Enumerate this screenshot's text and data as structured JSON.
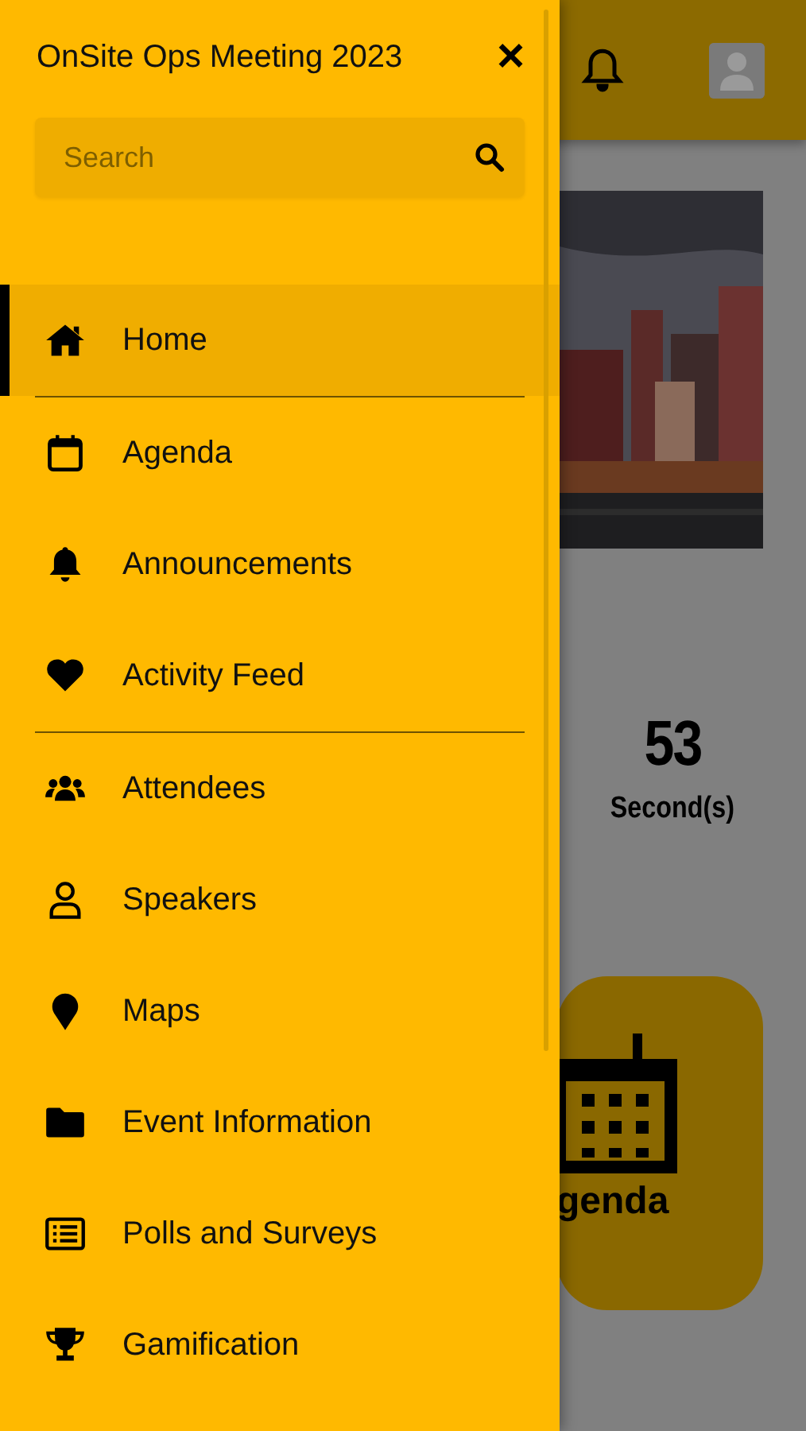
{
  "drawer": {
    "title": "OnSite Ops Meeting 2023",
    "close": "×",
    "search": {
      "placeholder": "Search"
    },
    "menu_groups": [
      [
        {
          "label": "Home",
          "selected": true
        }
      ],
      [
        {
          "label": "Agenda",
          "selected": false
        },
        {
          "label": "Announcements",
          "selected": false
        },
        {
          "label": "Activity Feed",
          "selected": false
        }
      ],
      [
        {
          "label": "Attendees",
          "selected": false
        },
        {
          "label": "Speakers",
          "selected": false
        },
        {
          "label": "Maps",
          "selected": false
        },
        {
          "label": "Event Information",
          "selected": false
        },
        {
          "label": "Polls and Surveys",
          "selected": false
        },
        {
          "label": "Gamification",
          "selected": false
        }
      ]
    ]
  },
  "background": {
    "countdown": {
      "value": "53",
      "unit": "Second(s)"
    },
    "tile": {
      "label": "genda"
    }
  }
}
